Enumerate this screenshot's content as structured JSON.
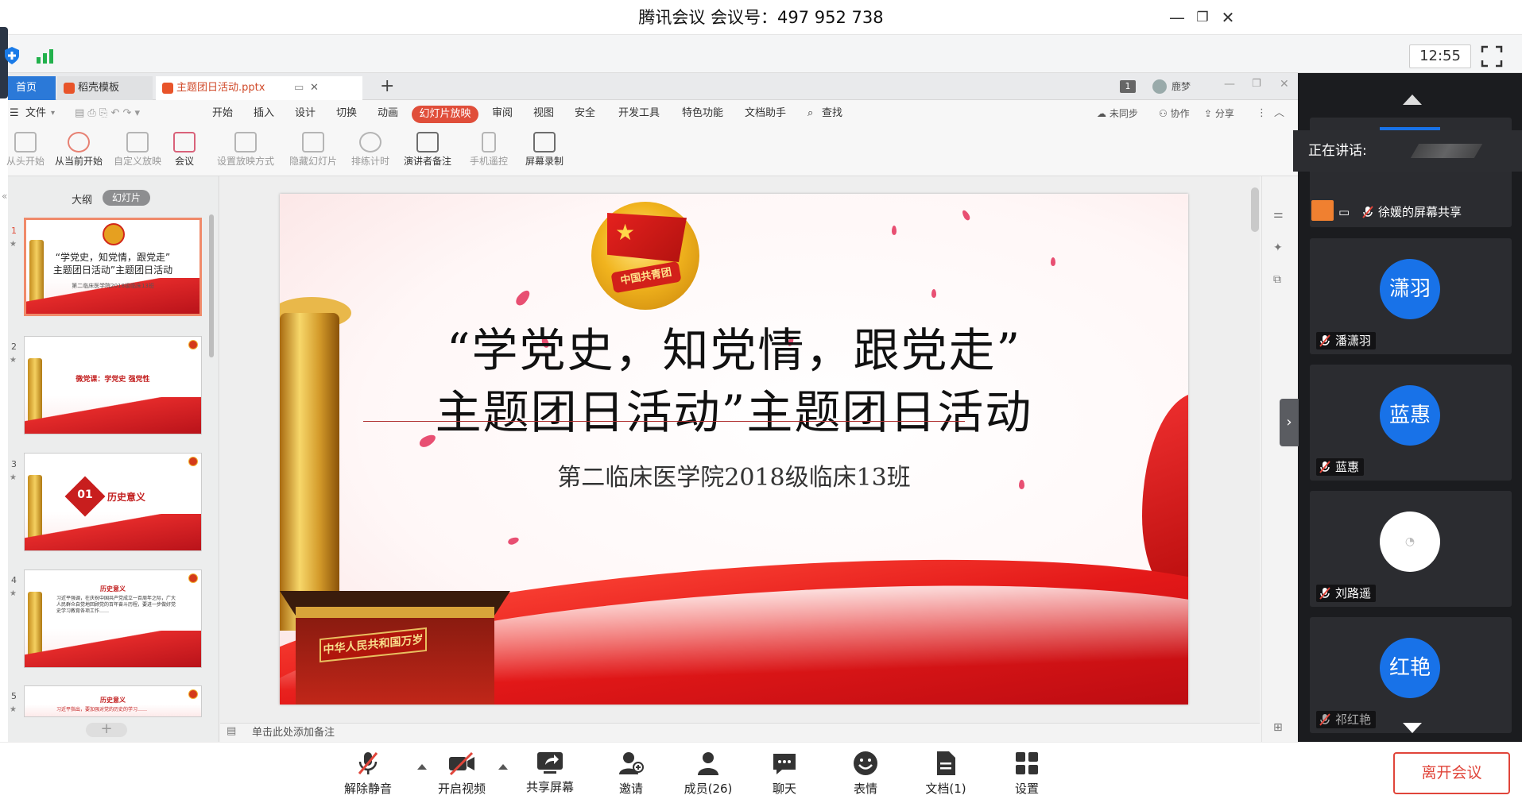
{
  "window": {
    "title": "腾讯会议 会议号：497 952 738",
    "time": "12:55"
  },
  "wps": {
    "tabs": [
      "首页",
      "稻壳模板",
      "主题团日活动.pptx"
    ],
    "account": "鹿梦",
    "page_badge": "1",
    "menu": [
      "文件",
      "开始",
      "插入",
      "设计",
      "切换",
      "动画",
      "幻灯片放映",
      "审阅",
      "视图",
      "安全",
      "开发工具",
      "特色功能",
      "文档助手",
      "查找"
    ],
    "menu_right": [
      "未同步",
      "协作",
      "分享"
    ],
    "ribbon": [
      "从头开始",
      "从当前开始",
      "自定义放映",
      "会议",
      "设置放映方式",
      "隐藏幻灯片",
      "排练计时",
      "演讲者备注",
      "手机遥控",
      "屏幕录制"
    ],
    "panel_tabs": [
      "大纲",
      "幻灯片"
    ],
    "thumbs": [
      {
        "num": "1",
        "line1": "“学党史，知党情，跟党走”",
        "line2": "主题团日活动”主题团日活动",
        "line3": "第二临床医学院2018级临床13班"
      },
      {
        "num": "2",
        "line1": "微党课：学党史 强党性"
      },
      {
        "num": "3",
        "badge": "01",
        "line1": "历史意义"
      },
      {
        "num": "4",
        "line1": "历史意义",
        "line2": "习近平强调，在庆祝中国共产党成立一百周年之际，广大人民群众自觉地回顾党的百年奋斗历程，要进一步做好党史学习教育各项工作……"
      },
      {
        "num": "5",
        "line1": "历史意义",
        "line2": "习近平指出，要加强对党的历史的学习……"
      }
    ],
    "slide": {
      "emblem_text": "中国共青团",
      "title1": "“学党史，知党情，跟党走”",
      "title2": "主题团日活动”主题团日活动",
      "subtitle": "第二临床医学院2018级临床13班",
      "gate_sign": "中华人民共和国万岁"
    },
    "notes_placeholder": "单击此处添加备注"
  },
  "panel": {
    "speaking_label": "正在讲话:",
    "share_name": "徐媛的屏幕共享",
    "participants": [
      {
        "avatar": "潇羽",
        "name": "潘潇羽"
      },
      {
        "avatar": "蓝惠",
        "name": "蓝惠"
      },
      {
        "avatar": "",
        "name": "刘路遥"
      },
      {
        "avatar": "红艳",
        "name": "祁红艳"
      }
    ]
  },
  "toolbar": {
    "buttons": [
      "解除静音",
      "开启视频",
      "共享屏幕",
      "邀请",
      "成员(26)",
      "聊天",
      "表情",
      "文档(1)",
      "设置"
    ],
    "leave": "离开会议"
  },
  "colors": {
    "accent_blue": "#1872e8",
    "wps_red": "#e04e3a",
    "leave_red": "#e0453a"
  }
}
